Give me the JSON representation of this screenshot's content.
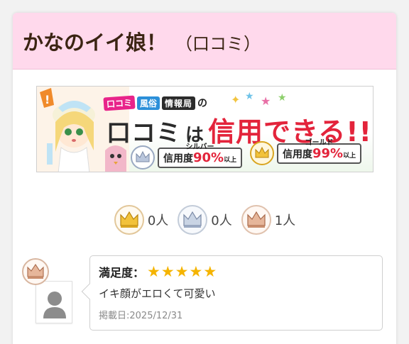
{
  "header": {
    "title": "かなのイイ娘！",
    "subtitle": "（口コミ）"
  },
  "banner": {
    "logo_tag_1": "口コミ",
    "logo_tag_2": "風俗",
    "logo_tag_3": "情報局",
    "logo_tail": "の",
    "headline_1": "口コミ",
    "headline_2": "は",
    "headline_3": "信用できる!!",
    "silver": {
      "label": "シルバー",
      "word": "信用度",
      "pct": "90%",
      "suffix": "以上"
    },
    "gold": {
      "label": "ゴールド",
      "word": "信用度",
      "pct": "99%",
      "suffix": "以上"
    }
  },
  "rank_counts": [
    {
      "icon": "gold-crown-icon",
      "count": "0人"
    },
    {
      "icon": "silver-crown-icon",
      "count": "0人"
    },
    {
      "icon": "bronze-crown-icon",
      "count": "1人"
    }
  ],
  "review": {
    "rank_icon": "bronze-crown-icon",
    "satisfaction_label": "満足度：",
    "rating": 5,
    "stars": [
      "★",
      "★",
      "★",
      "★",
      "★"
    ],
    "comment": "イキ顔がエロくて可愛い",
    "date": "掲載日:2025/12/31"
  },
  "colors": {
    "header_bg": "#ffd9ec",
    "title": "#3b2413",
    "star": "#f5b400",
    "accent_red": "#e3243b"
  }
}
